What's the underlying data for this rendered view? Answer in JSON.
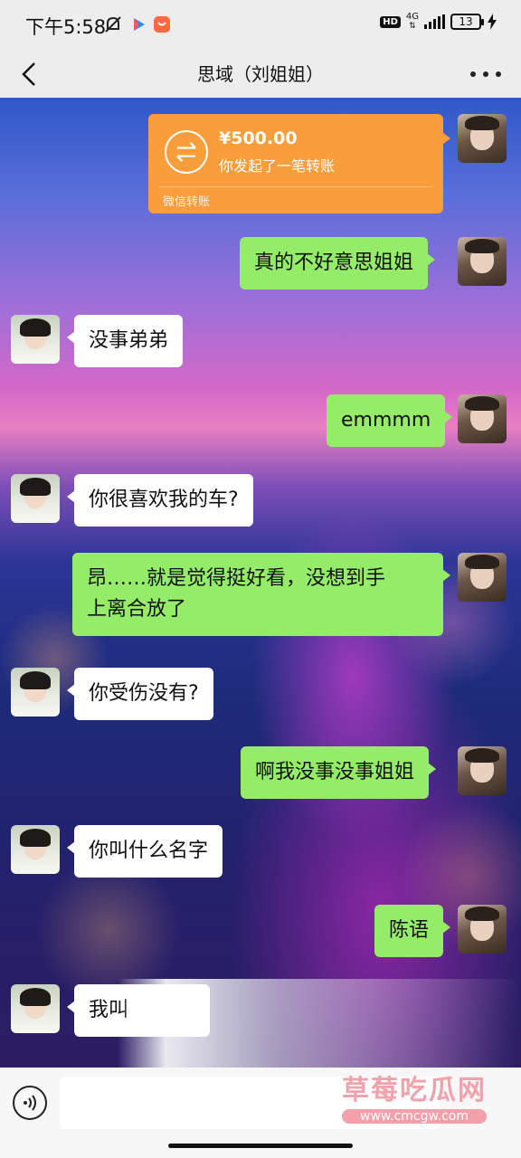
{
  "status_bar": {
    "time": "下午5:58",
    "hd": "HD",
    "network": "4G",
    "battery": "13"
  },
  "nav": {
    "title": "思域（刘姐姐）"
  },
  "transfer": {
    "amount": "¥500.00",
    "description": "你发起了一笔转账",
    "footer": "微信转账"
  },
  "messages": [
    {
      "from": "me",
      "text": "真的不好意思姐姐"
    },
    {
      "from": "her",
      "text": "没事弟弟"
    },
    {
      "from": "me",
      "text": "emmmm"
    },
    {
      "from": "her",
      "text": "你很喜欢我的车?"
    },
    {
      "from": "me",
      "text": "昂……就是觉得挺好看，没想到手上离合放了",
      "line1": "昂……就是觉得挺好看，没想到手",
      "line2": "上离合放了"
    },
    {
      "from": "her",
      "text": "你受伤没有?"
    },
    {
      "from": "me",
      "text": "啊我没事没事姐姐"
    },
    {
      "from": "her",
      "text": "你叫什么名字"
    },
    {
      "from": "me",
      "text": "陈语"
    },
    {
      "from": "her",
      "text": "我叫"
    }
  ],
  "watermark": {
    "main": "草莓吃瓜网",
    "sub": "www.cmcgw.com"
  },
  "colors": {
    "bubble_me": "#95ec69",
    "bubble_her": "#ffffff",
    "transfer": "#fa9d3b"
  }
}
